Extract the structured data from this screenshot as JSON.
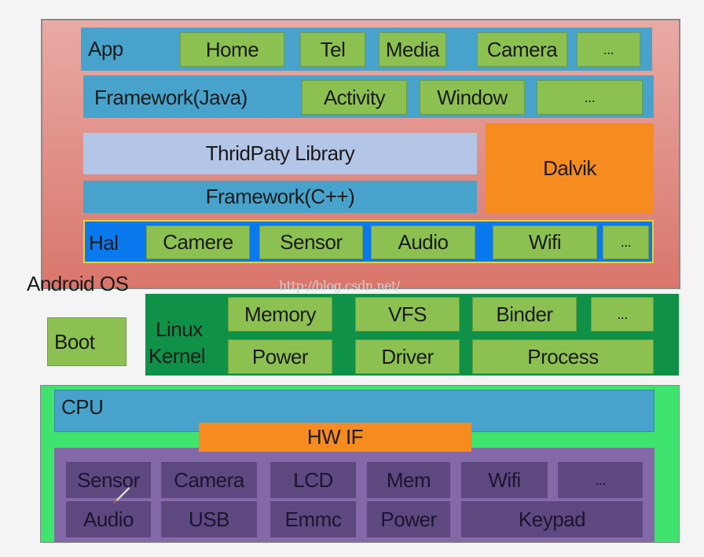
{
  "android_os": {
    "label": "Android OS",
    "app": {
      "label": "App",
      "items": [
        "Home",
        "Tel",
        "Media",
        "Camera",
        "..."
      ]
    },
    "framework_java": {
      "label": "Framework(Java)",
      "items": [
        "Activity",
        "Window",
        "..."
      ]
    },
    "thirdparty": "ThridPaty Library",
    "framework_cpp": "Framework(C++)",
    "dalvik": "Dalvik",
    "hal": {
      "label": "Hal",
      "items": [
        "Camere",
        "Sensor",
        "Audio",
        "Wifi",
        "..."
      ]
    }
  },
  "watermark": "http://blog.csdn.net/",
  "boot": "Boot",
  "kernel": {
    "label_line1": "Linux",
    "label_line2": "Kernel",
    "items": [
      "Memory",
      "VFS",
      "Binder",
      "...",
      "Power",
      "Driver",
      "Process"
    ]
  },
  "hardware": {
    "cpu": "CPU",
    "hw_if": "HW IF",
    "items": [
      "Sensor",
      "Camera",
      "LCD",
      "Mem",
      "Wifi",
      "...",
      "Audio",
      "USB",
      "Emmc",
      "Power",
      "Keypad"
    ]
  },
  "colors": {
    "android_os": "#e0938a",
    "layer_blue": "#47a3cc",
    "module_green": "#8cc152",
    "hal_blue": "#0a79ee",
    "dalvik_orange": "#f68b1f",
    "thirdparty": "#b4c6e7",
    "kernel_green": "#0f9147",
    "hardware_green": "#3ee46e",
    "hardware_purple": "#8469a8",
    "hw_module": "#5d4880"
  }
}
